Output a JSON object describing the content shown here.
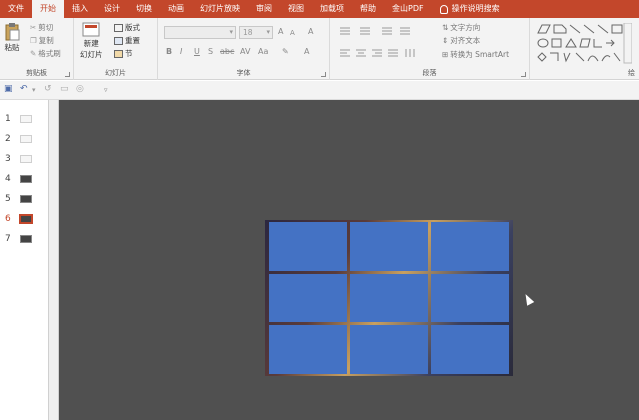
{
  "tabs": [
    "文件",
    "开始",
    "插入",
    "设计",
    "切换",
    "动画",
    "幻灯片放映",
    "审阅",
    "视图",
    "加载项",
    "帮助",
    "金山PDF",
    "操作说明搜索"
  ],
  "active_tab": "开始",
  "clipboard": {
    "paste": "粘贴",
    "cut": "剪切",
    "copy": "复制",
    "format_painter": "格式刷",
    "label": "剪贴板"
  },
  "slides_group": {
    "new_slide": "新建",
    "new_slide_2": "幻灯片",
    "layout": "版式",
    "reset": "重置",
    "section": "节",
    "label": "幻灯片"
  },
  "font": {
    "size": "18",
    "label": "字体",
    "bold": "B",
    "italic": "I",
    "underline": "U",
    "strike": "S",
    "shadow": "abc",
    "spacing": "AV",
    "case": "Aa",
    "grow": "A",
    "shrink": "A",
    "color": "A",
    "clear": "A"
  },
  "paragraph": {
    "text_direction": "文字方向",
    "align_text": "对齐文本",
    "smartart": "转换为 SmartArt",
    "label": "段落"
  },
  "drawing_label": "绘",
  "thumbnails": [
    1,
    2,
    3,
    4,
    5,
    6,
    7
  ],
  "current_slide": 6,
  "grid": {
    "rows": 3,
    "cols": 3,
    "color": "#4472c4"
  }
}
